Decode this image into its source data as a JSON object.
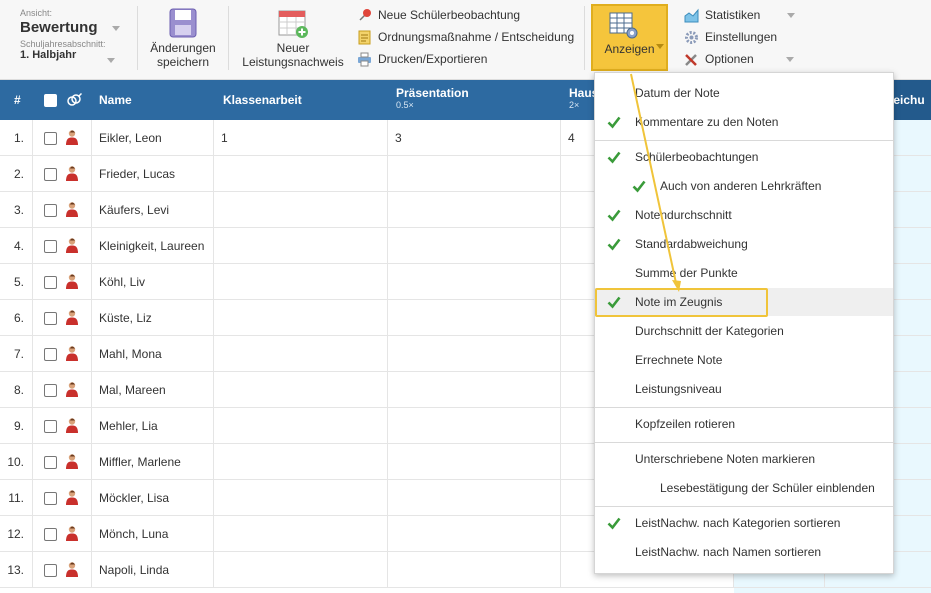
{
  "toolbar": {
    "view_label": "Ansicht:",
    "view_value": "Bewertung",
    "term_label": "Schuljahresabschnitt:",
    "term_value": "1. Halbjahr",
    "save_label_1": "Änderungen",
    "save_label_2": "speichern",
    "new_label_1": "Neuer",
    "new_label_2": "Leistungsnachweis",
    "obs_label": "Neue Schülerbeobachtung",
    "measure_label": "Ordnungsmaßnahme / Entscheidung",
    "print_label": "Drucken/Exportieren",
    "show_label": "Anzeigen",
    "stats_label": "Statistiken",
    "settings_label": "Einstellungen",
    "options_label": "Optionen"
  },
  "table": {
    "col_hash": "#",
    "col_name": "Name",
    "col_klassenarbeit": "Klassenarbeit",
    "col_praesentation": "Präsentation",
    "col_praesentation_sub": "0.5×",
    "col_haus": "Haus",
    "col_haus_sub": "2×",
    "col_right": "weichu",
    "rows": [
      {
        "n": "1.",
        "name": "Eikler, Leon",
        "k": "1",
        "p": "3",
        "h": "4"
      },
      {
        "n": "2.",
        "name": "Frieder, Lucas",
        "k": "",
        "p": "",
        "h": ""
      },
      {
        "n": "3.",
        "name": "Käufers, Levi",
        "k": "",
        "p": "",
        "h": ""
      },
      {
        "n": "4.",
        "name": "Kleinigkeit, Laureen",
        "k": "",
        "p": "",
        "h": ""
      },
      {
        "n": "5.",
        "name": "Köhl, Liv",
        "k": "",
        "p": "",
        "h": ""
      },
      {
        "n": "6.",
        "name": "Küste, Liz",
        "k": "",
        "p": "",
        "h": ""
      },
      {
        "n": "7.",
        "name": "Mahl, Mona",
        "k": "",
        "p": "",
        "h": ""
      },
      {
        "n": "8.",
        "name": "Mal, Mareen",
        "k": "",
        "p": "",
        "h": ""
      },
      {
        "n": "9.",
        "name": "Mehler, Lia",
        "k": "",
        "p": "",
        "h": ""
      },
      {
        "n": "10.",
        "name": "Miffler, Marlene",
        "k": "",
        "p": "",
        "h": ""
      },
      {
        "n": "11.",
        "name": "Möckler, Lisa",
        "k": "",
        "p": "",
        "h": ""
      },
      {
        "n": "12.",
        "name": "Mönch, Luna",
        "k": "",
        "p": "",
        "h": ""
      },
      {
        "n": "13.",
        "name": "Napoli, Linda",
        "k": "",
        "p": "",
        "h": ""
      }
    ]
  },
  "menu": {
    "items": [
      {
        "label": "Datum der Note",
        "checked": false
      },
      {
        "label": "Kommentare zu den Noten",
        "checked": true
      },
      {
        "label": "Schülerbeobachtungen",
        "checked": true
      },
      {
        "label": "Auch von anderen Lehrkräften",
        "checked": true
      },
      {
        "label": "Notendurchschnitt",
        "checked": true
      },
      {
        "label": "Standardabweichung",
        "checked": true
      },
      {
        "label": "Summe der Punkte",
        "checked": false
      },
      {
        "label": "Note im Zeugnis",
        "checked": true
      },
      {
        "label": "Durchschnitt der Kategorien",
        "checked": false
      },
      {
        "label": "Errechnete Note",
        "checked": false
      },
      {
        "label": "Leistungsniveau",
        "checked": false
      },
      {
        "label": "Kopfzeilen rotieren",
        "checked": false
      },
      {
        "label": "Unterschriebene Noten markieren",
        "checked": false
      },
      {
        "label": "Lesebestätigung der Schüler einblenden",
        "checked": false
      },
      {
        "label": "LeistNachw. nach Kategorien sortieren",
        "checked": true
      },
      {
        "label": "LeistNachw. nach Namen sortieren",
        "checked": false
      }
    ]
  },
  "colors": {
    "header_blue": "#2d6aa1",
    "accent_yellow": "#f5c53c",
    "check_green": "#3a9b3a"
  }
}
